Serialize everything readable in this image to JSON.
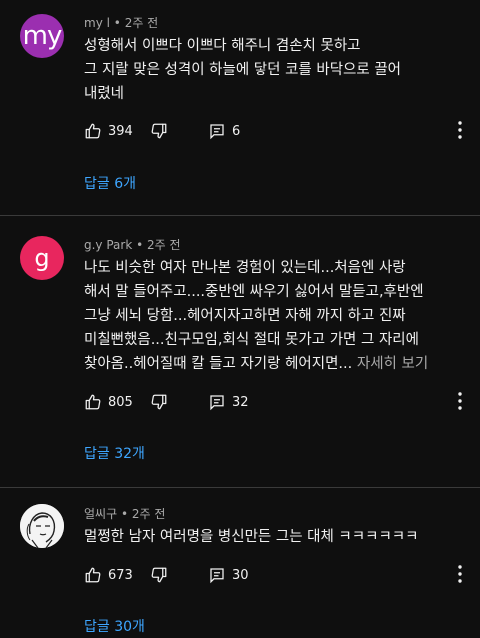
{
  "comments": [
    {
      "avatar_text": "my",
      "author": "my l",
      "time": "2주 전",
      "lines": [
        "성형해서 이쁘다 이쁘다 해주니 겸손치 못하고",
        "그 지랄 맞은 성격이 하늘에 닿던 코를 바닥으로 끌어",
        "내렸네"
      ],
      "likes": "394",
      "reply_count": "6",
      "replies_label": "답글 6개",
      "avatar_color": "#9b2fb0"
    },
    {
      "avatar_text": "g",
      "author": "g.y Park",
      "time": "2주 전",
      "lines": [
        "나도 비슷한 여자 만나본 경험이 있는데...처음엔 사랑",
        "해서 말 들어주고....중반엔 싸우기 싫어서 말듣고,후반엔",
        "그냥 세뇌 당함...헤어지자고하면 자해 까지 하고 진짜",
        "미칠뻔했음...친구모임,회식 절대 못가고 가면 그 자리에",
        "찾아옴..헤어질때 칼 들고 자기랑 헤어지면..."
      ],
      "read_more": "자세히 보기",
      "likes": "805",
      "reply_count": "32",
      "replies_label": "답글 32개",
      "avatar_color": "#e8265e"
    },
    {
      "author": "얼씨구",
      "time": "2주 전",
      "lines": [
        "멀쩡한 남자 여러명을 병신만든 그는 대체 ㅋㅋㅋㅋㅋㅋ"
      ],
      "likes": "673",
      "reply_count": "30",
      "replies_label": "답글 30개"
    }
  ],
  "meta_separator": "•",
  "colors": {
    "background": "#0f0f0f",
    "link": "#3ea6ff",
    "meta": "#aaaaaa"
  },
  "icons": [
    "thumbs-up-icon",
    "thumbs-down-icon",
    "comment-icon",
    "more-vert-icon"
  ]
}
